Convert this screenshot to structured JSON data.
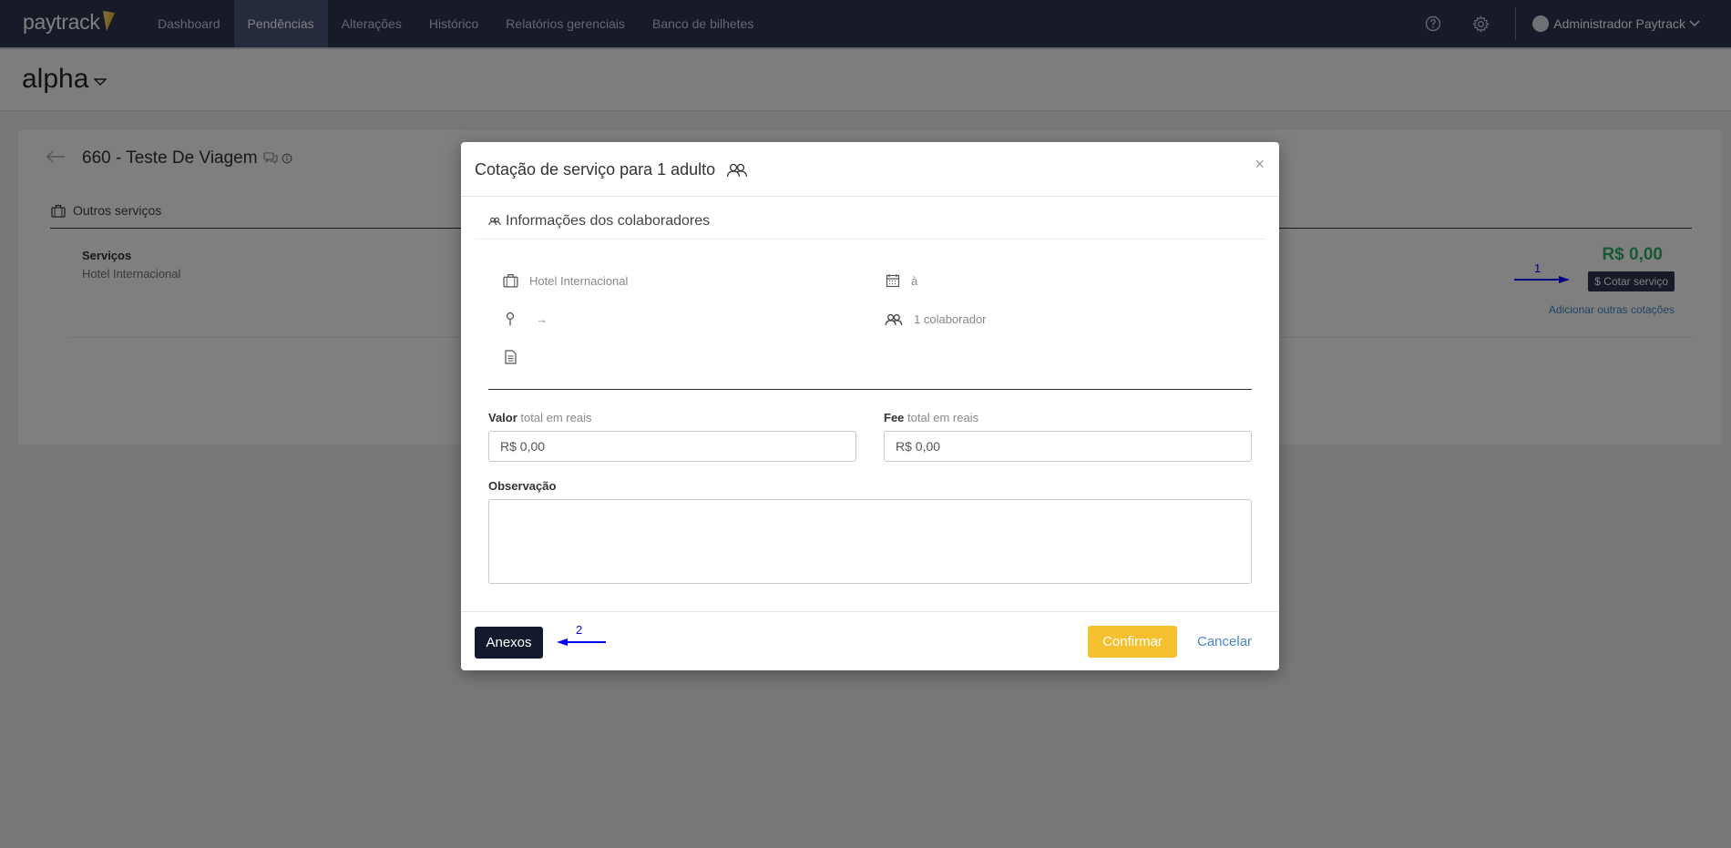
{
  "nav": {
    "logo": "paytrack",
    "items": [
      "Dashboard",
      "Pendências",
      "Alterações",
      "Histórico",
      "Relatórios gerenciais",
      "Banco de bilhetes"
    ],
    "active_index": 1,
    "help_icon": "question-circle-icon",
    "settings_icon": "gear-icon",
    "user": "Administrador Paytrack"
  },
  "company": "alpha",
  "trip": {
    "title": "660 - Teste De Viagem",
    "section": "Outros serviços",
    "services_label": "Serviços",
    "service_name": "Hotel Internacional",
    "price": "R$ 0,00",
    "quote_button": "$ Cotar serviço",
    "add_quotes": "Adicionar outras cotações"
  },
  "annotations": {
    "one": "1",
    "two": "2"
  },
  "modal": {
    "title": "Cotação de serviço para 1 adulto",
    "close": "×",
    "info_heading": "Informações dos colaboradores",
    "hotel": "Hotel Internacional",
    "dates": "à",
    "route": "→",
    "collaborators": "1 colaborador",
    "valor_label_bold": "Valor",
    "valor_label_rest": "total em reais",
    "valor_value": "R$ 0,00",
    "fee_label_bold": "Fee",
    "fee_label_rest": "total em reais",
    "fee_value": "R$ 0,00",
    "obs_label": "Observação",
    "anexos_button": "Anexos",
    "confirm_button": "Confirmar",
    "cancel_button": "Cancelar"
  },
  "colors": {
    "navbar": "#2f3650",
    "price_green": "#2fb36b",
    "confirm_yellow": "#f6c02e",
    "link_blue": "#4a86c5",
    "annotation_blue": "#0000ff"
  }
}
